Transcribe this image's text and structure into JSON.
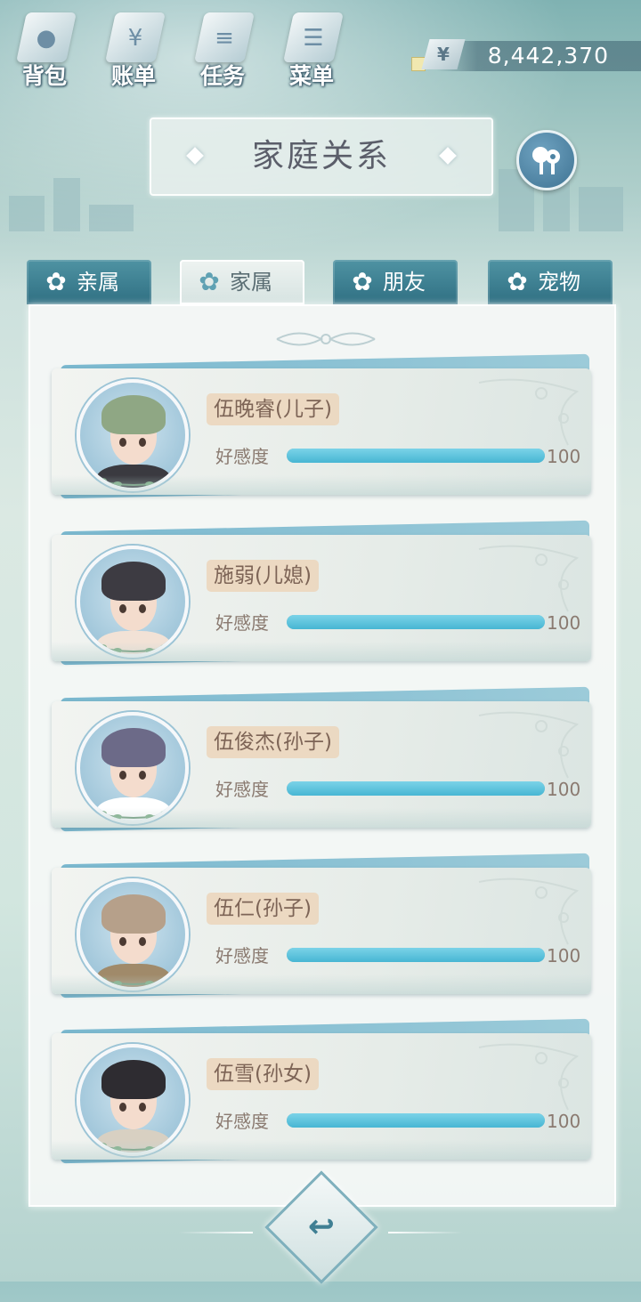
{
  "top_menu": [
    {
      "label": "背包",
      "icon": "bag-icon"
    },
    {
      "label": "账单",
      "icon": "bill-icon"
    },
    {
      "label": "任务",
      "icon": "task-icon"
    },
    {
      "label": "菜单",
      "icon": "menu-icon"
    }
  ],
  "currency": {
    "symbol": "¥",
    "value": "8,442,370"
  },
  "title": "家庭关系",
  "family_tree_icon": "family-tree-icon",
  "tabs": [
    {
      "label": "亲属",
      "active": false
    },
    {
      "label": "家属",
      "active": true
    },
    {
      "label": "朋友",
      "active": false
    },
    {
      "label": "宠物",
      "active": false
    }
  ],
  "members": [
    {
      "name": "伍晚睿(儿子)",
      "affinity_label": "好感度",
      "affinity": 100,
      "affinity_text": "100",
      "hair_color": "#8fa784",
      "cloth_color": "#3a3a40"
    },
    {
      "name": "施弱(儿媳)",
      "affinity_label": "好感度",
      "affinity": 100,
      "affinity_text": "100",
      "hair_color": "#3d3b42",
      "cloth_color": "#f2e2d6"
    },
    {
      "name": "伍俊杰(孙子)",
      "affinity_label": "好感度",
      "affinity": 100,
      "affinity_text": "100",
      "hair_color": "#6c6a88",
      "cloth_color": "#ffffff"
    },
    {
      "name": "伍仁(孙子)",
      "affinity_label": "好感度",
      "affinity": 100,
      "affinity_text": "100",
      "hair_color": "#b6a08a",
      "cloth_color": "#a08a6a"
    },
    {
      "name": "伍雪(孙女)",
      "affinity_label": "好感度",
      "affinity": 100,
      "affinity_text": "100",
      "hair_color": "#2e2c31",
      "cloth_color": "#d8d0c2"
    }
  ],
  "affinity_max": 100,
  "back_icon": "return-arrow-icon"
}
